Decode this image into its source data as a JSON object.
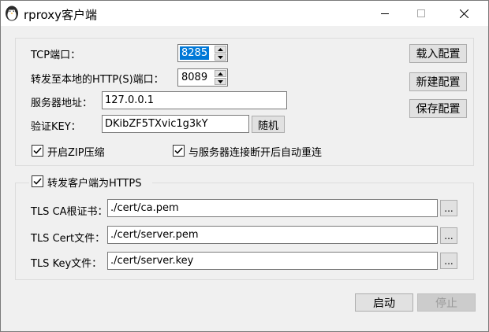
{
  "window": {
    "title": "rproxy客户端",
    "controls": {
      "minimize": "minimize-icon",
      "maximize": "maximize-icon",
      "close": "close-icon"
    }
  },
  "settings": {
    "tcp_port_label": "TCP端口：",
    "tcp_port_value": "8285",
    "forward_port_label": "转发至本地的HTTP(S)端口：",
    "forward_port_value": "8089",
    "server_addr_label": "服务器地址：",
    "server_addr_value": "127.0.0.1",
    "verify_key_label": "验证KEY：",
    "verify_key_value": "DKibZF5TXvic1g3kY",
    "random_button": "随机",
    "zip_label": "开启ZIP压缩",
    "zip_checked": true,
    "reconnect_label": "与服务器连接断开后自动重连",
    "reconnect_checked": true
  },
  "config_buttons": {
    "load": "载入配置",
    "new": "新建配置",
    "save": "保存配置"
  },
  "https": {
    "enable_label": "转发客户端为HTTPS",
    "enable_checked": true,
    "ca_label": "TLS CA根证书：",
    "ca_value": "./cert/ca.pem",
    "cert_label": "TLS Cert文件：",
    "cert_value": "./cert/server.pem",
    "key_label": "TLS Key文件：",
    "key_value": "./cert/server.key",
    "browse_label": "..."
  },
  "actions": {
    "start": "启动",
    "stop": "停止"
  }
}
